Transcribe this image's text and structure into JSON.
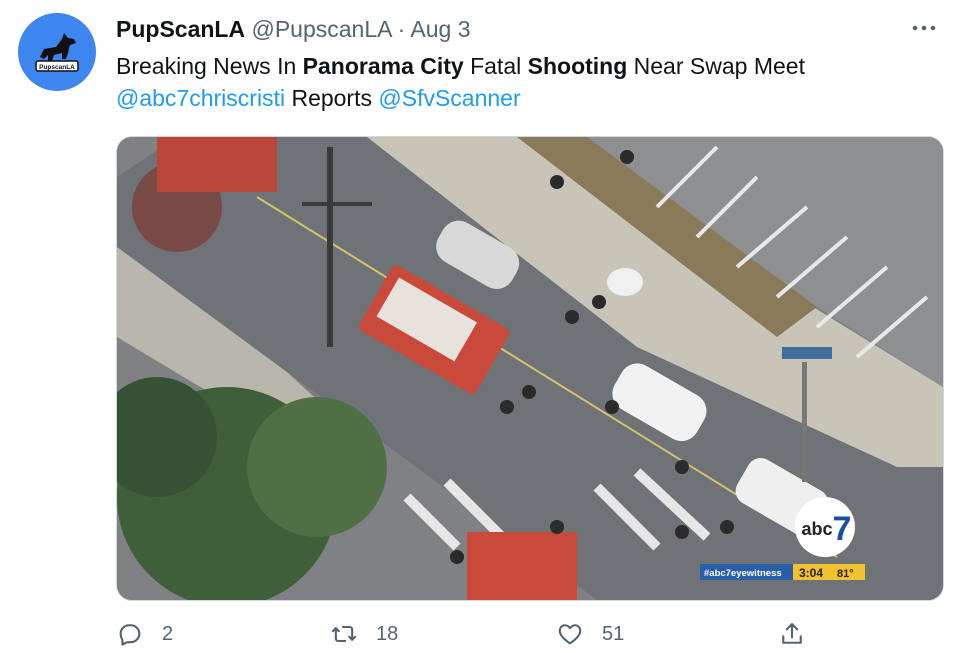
{
  "author": {
    "display_name": "PupScanLA",
    "handle": "@PupscanLA",
    "separator": "·",
    "date": "Aug 3",
    "avatar_text": "PupscanLA"
  },
  "tweet": {
    "t1": "Breaking News In ",
    "b1": "Panorama City",
    "t2": " Fatal ",
    "b2": "Shooting",
    "t3": " Near Swap Meet",
    "mention1": "@abc7chriscristi",
    "t4": " Reports ",
    "mention2": "@SfvScanner"
  },
  "media": {
    "logo_text": "abc",
    "logo_number": "7",
    "hashtag": "#abc7eyewitness",
    "time": "3:04",
    "temp": "81°"
  },
  "actions": {
    "replies": "2",
    "retweets": "18",
    "likes": "51"
  },
  "icons": [
    "dog-logo-icon",
    "more-icon",
    "reply-icon",
    "retweet-icon",
    "like-icon",
    "share-icon"
  ],
  "colors": {
    "link": "#1d9bf0",
    "avatar_bg": "#3d86f0",
    "muted": "#536471"
  }
}
